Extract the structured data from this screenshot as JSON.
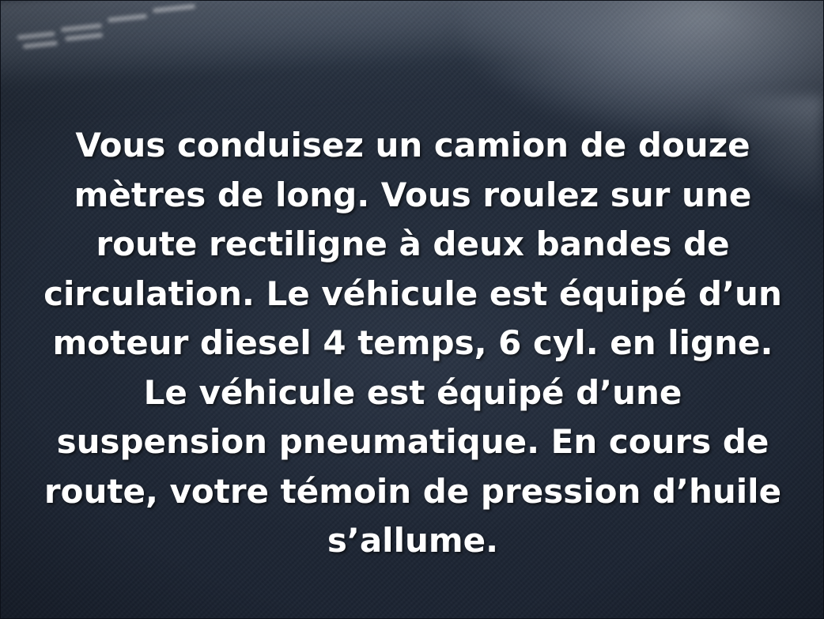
{
  "slide": {
    "body_text": "Vous conduisez un camion de douze\nmètres de long. Vous roulez sur une\nroute rectiligne à deux bandes de\ncirculation. Le véhicule est équipé d’un\nmoteur diesel 4 temps, 6 cyl. en ligne.\nLe véhicule est équipé d’une\nsuspension pneumatique. En cours de\nroute, votre témoin de pression d’huile\ns’allume.",
    "text_color": "#ffffff",
    "background_color": "#1d2634"
  }
}
